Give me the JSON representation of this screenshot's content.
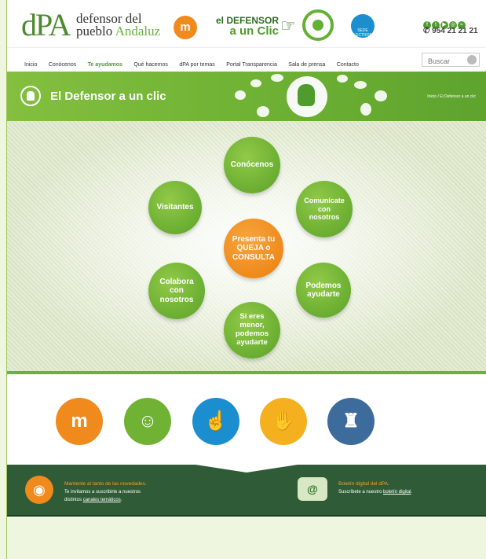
{
  "header": {
    "logo_mark": "dPA",
    "logo_line1": "defensor del",
    "logo_line2a": "pueblo",
    "logo_line2b": "Andaluz",
    "mm_badge": "m",
    "clic_line1": "el DEFENSOR",
    "clic_line2a": "a un",
    "clic_line2b": "Clic",
    "sede_label": "SEDE ELECTRONICA",
    "social_icons": [
      "facebook-icon",
      "twitter-icon",
      "youtube-icon",
      "instagram-icon",
      "rss-icon"
    ],
    "phone": "954 21 21 21"
  },
  "nav": {
    "items": [
      "Inicio",
      "Conócenos",
      "Te ayudamos",
      "Qué hacemos",
      "dPA por temas",
      "Portal Transparencia",
      "Sala de prensa",
      "Contacto"
    ],
    "active": "Te ayudamos"
  },
  "search": {
    "placeholder": "Buscar"
  },
  "banner": {
    "title": "El Defensor a un clic",
    "breadcrumb_home": "Inicio",
    "breadcrumb_sep": "/",
    "breadcrumb_current": "El Defensor a un clic"
  },
  "hero": {
    "center": "Presenta tu QUEJA o CONSULTA",
    "top": "Conócenos",
    "left_top": "Visitantes",
    "right_top": "Comunícate con nosotros",
    "left_bottom": "Colabora con nosotros",
    "right_bottom": "Podemos ayudarte",
    "bottom": "Si eres menor, podemos ayudarte"
  },
  "icons": [
    {
      "name": "menores-icon",
      "color": "#f08a1c"
    },
    {
      "name": "ciudadania-icon",
      "color": "#6fb234"
    },
    {
      "name": "clic-hand-icon",
      "color": "#1b8ed0"
    },
    {
      "name": "handshake-icon",
      "color": "#f5b020"
    },
    {
      "name": "parlamento-icon",
      "color": "#3d6b9c"
    }
  ],
  "footer": {
    "left_title": "Mantente al tanto de las novedades.",
    "left_line2": "Te invitamos a suscribirte a nuestros",
    "left_line3a": "distintos",
    "left_link": "canales temáticos",
    "left_line3b": ".",
    "right_title": "Boletín digital del dPA.",
    "right_line2a": "Suscríbete a nuestro",
    "right_link": "boletín digital",
    "right_line2b": ".",
    "mail_glyph": "@"
  }
}
